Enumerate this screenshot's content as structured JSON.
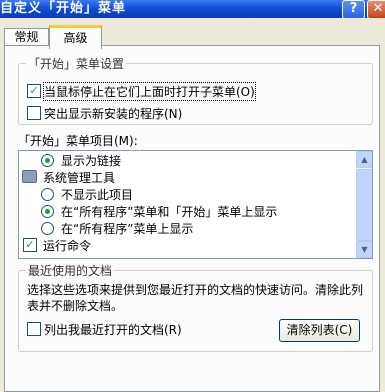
{
  "window": {
    "title": "自定义「开始」菜单",
    "help_glyph": "?",
    "close_glyph": "✕"
  },
  "tabs": [
    {
      "label": "常规",
      "selected": false
    },
    {
      "label": "高级",
      "selected": true
    }
  ],
  "start_menu_settings": {
    "group_title": "「开始」菜单设置",
    "open_submenus": {
      "label": "当鼠标停止在它们上面时打开子菜单(O)",
      "checked": true
    },
    "highlight_new": {
      "label": "突出显示新安装的程序(N)",
      "checked": false
    }
  },
  "start_menu_items": {
    "label": "「开始」菜单项目(M):",
    "rows": {
      "link_option": "显示为链接",
      "admin_tools": "系统管理工具",
      "not_shown": "不显示此项目",
      "show_all_and_start": "在“所有程序”菜单和「开始」菜单上显示",
      "show_all_only": "在“所有程序”菜单上显示",
      "run_command": "运行命令"
    },
    "selected": {
      "link_option": true,
      "not_shown": false,
      "show_all_and_start": true,
      "show_all_only": false,
      "run_command": true
    }
  },
  "recent_documents": {
    "group_title": "最近使用的文档",
    "description_line1": "选择这些选项来提供到您最近打开的文档的快速访问。清除此列",
    "description_line2": "表并不删除文档。",
    "list_recent": {
      "label": "列出我最近打开的文档(R)",
      "checked": false
    },
    "clear_list_button": "清除列表(C)"
  },
  "glyphs": {
    "check": "✓",
    "scroll_up": "▲",
    "scroll_down": "▼"
  },
  "colors": {
    "titlebar_blue": "#0b43c6",
    "window_bg": "#ece9d8",
    "panel_bg": "#fcfcfe",
    "check_green": "#21a121",
    "tab_highlight": "#ffc83c"
  }
}
